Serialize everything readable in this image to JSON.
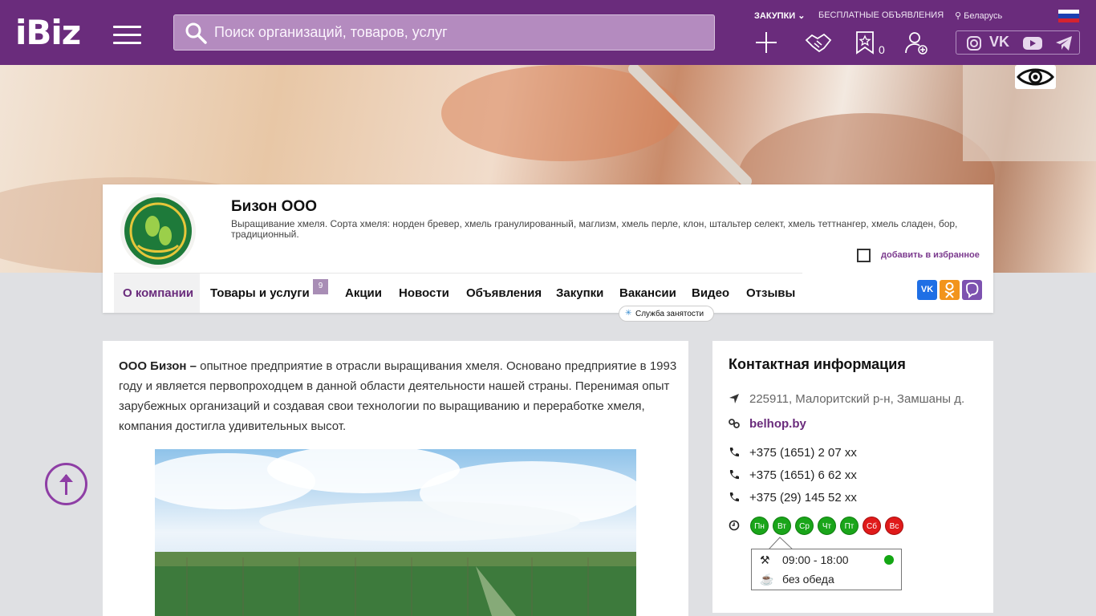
{
  "header": {
    "logo": "iBiz",
    "search_placeholder": "Поиск организаций, товаров, услуг",
    "links": {
      "purchases": "ЗАКУПКИ",
      "free_ads": "БЕСПЛАТНЫЕ ОБЪЯВЛЕНИЯ",
      "region": "Беларусь"
    },
    "favorites_count": "0",
    "icons": [
      "menu-icon",
      "search-icon",
      "plus-icon",
      "handshake-icon",
      "star-bookmark-icon",
      "add-user-icon",
      "instagram-icon",
      "vk-icon",
      "youtube-icon",
      "telegram-icon",
      "eye-icon"
    ],
    "colors": {
      "brand": "#6a2c7c",
      "accent": "#8e3ea5"
    }
  },
  "company": {
    "name": "Бизон ООО",
    "description": "Выращивание хмеля. Сорта хмеля: норден бревер, хмель гранулированный, маглизм, хмель перле, клон, штальтер селект, хмель теттнангер, хмель сладен, бор, традиционный.",
    "add_favorite": "добавить в избранное",
    "tabs": [
      "О компании",
      "Товары и услуги",
      "Акции",
      "Новости",
      "Объявления",
      "Закупки",
      "Вакансии",
      "Видео",
      "Отзывы"
    ],
    "products_count": "9",
    "tooltip": "Служба занятости",
    "share_icons": [
      "vk-share-icon",
      "ok-share-icon",
      "viber-share-icon"
    ]
  },
  "about": {
    "lead": "ООО Бизон –",
    "text": " опытное предприятие в отрасли выращивания хмеля. Основано предприятие в 1993 году и является первопроходцем в данной области деятельности нашей страны. Перенимая опыт зарубежных организаций и создавая свои технологии по выращиванию и переработке хмеля, компания достигла удивительных высот."
  },
  "contacts": {
    "title": "Контактная информация",
    "address": "225911, Малоритский р-н, Замшаны д.",
    "site": "belhop.by",
    "phones": [
      "+375 (1651) 2 07 xx",
      "+375 (1651) 6 62 xx",
      "+375 (29) 145 52 xx"
    ],
    "days": [
      {
        "label": "Пн",
        "status": "work"
      },
      {
        "label": "Вт",
        "status": "work"
      },
      {
        "label": "Ср",
        "status": "work"
      },
      {
        "label": "Чт",
        "status": "work"
      },
      {
        "label": "Пт",
        "status": "work"
      },
      {
        "label": "Сб",
        "status": "off"
      },
      {
        "label": "Вс",
        "status": "off"
      }
    ],
    "hours": "09:00 - 18:00",
    "lunch": "без обеда"
  }
}
